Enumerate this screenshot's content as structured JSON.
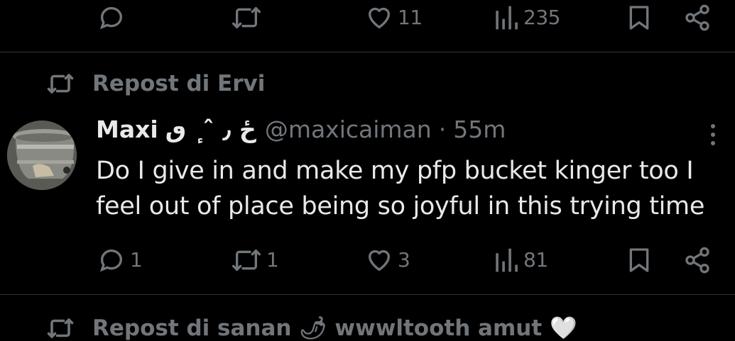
{
  "colors": {
    "background": "#000000",
    "text_primary": "#e7e9ea",
    "text_secondary": "#71767b",
    "divider": "#2f3336"
  },
  "prev_post": {
    "actions": {
      "reply_count": "",
      "repost_count": "",
      "like_count": "11",
      "view_count": "235"
    }
  },
  "repost_header": {
    "label": "Repost di Ervi",
    "icon": "repost-icon"
  },
  "tweet": {
    "display_name": "Maxi",
    "name_glyphs": "ځ ٫ ˆ ٕ ٯ",
    "handle": "@maxicaiman",
    "separator": "·",
    "time": "55m",
    "text": "Do I give in and make my pfp bucket kinger too I feel out of place being so joyful in this trying time",
    "actions": {
      "reply_count": "1",
      "repost_count": "1",
      "like_count": "3",
      "view_count": "81"
    }
  },
  "next_repost_header": {
    "label": "Repost di sanan 🌶 wwwltooth amut 🤍"
  }
}
